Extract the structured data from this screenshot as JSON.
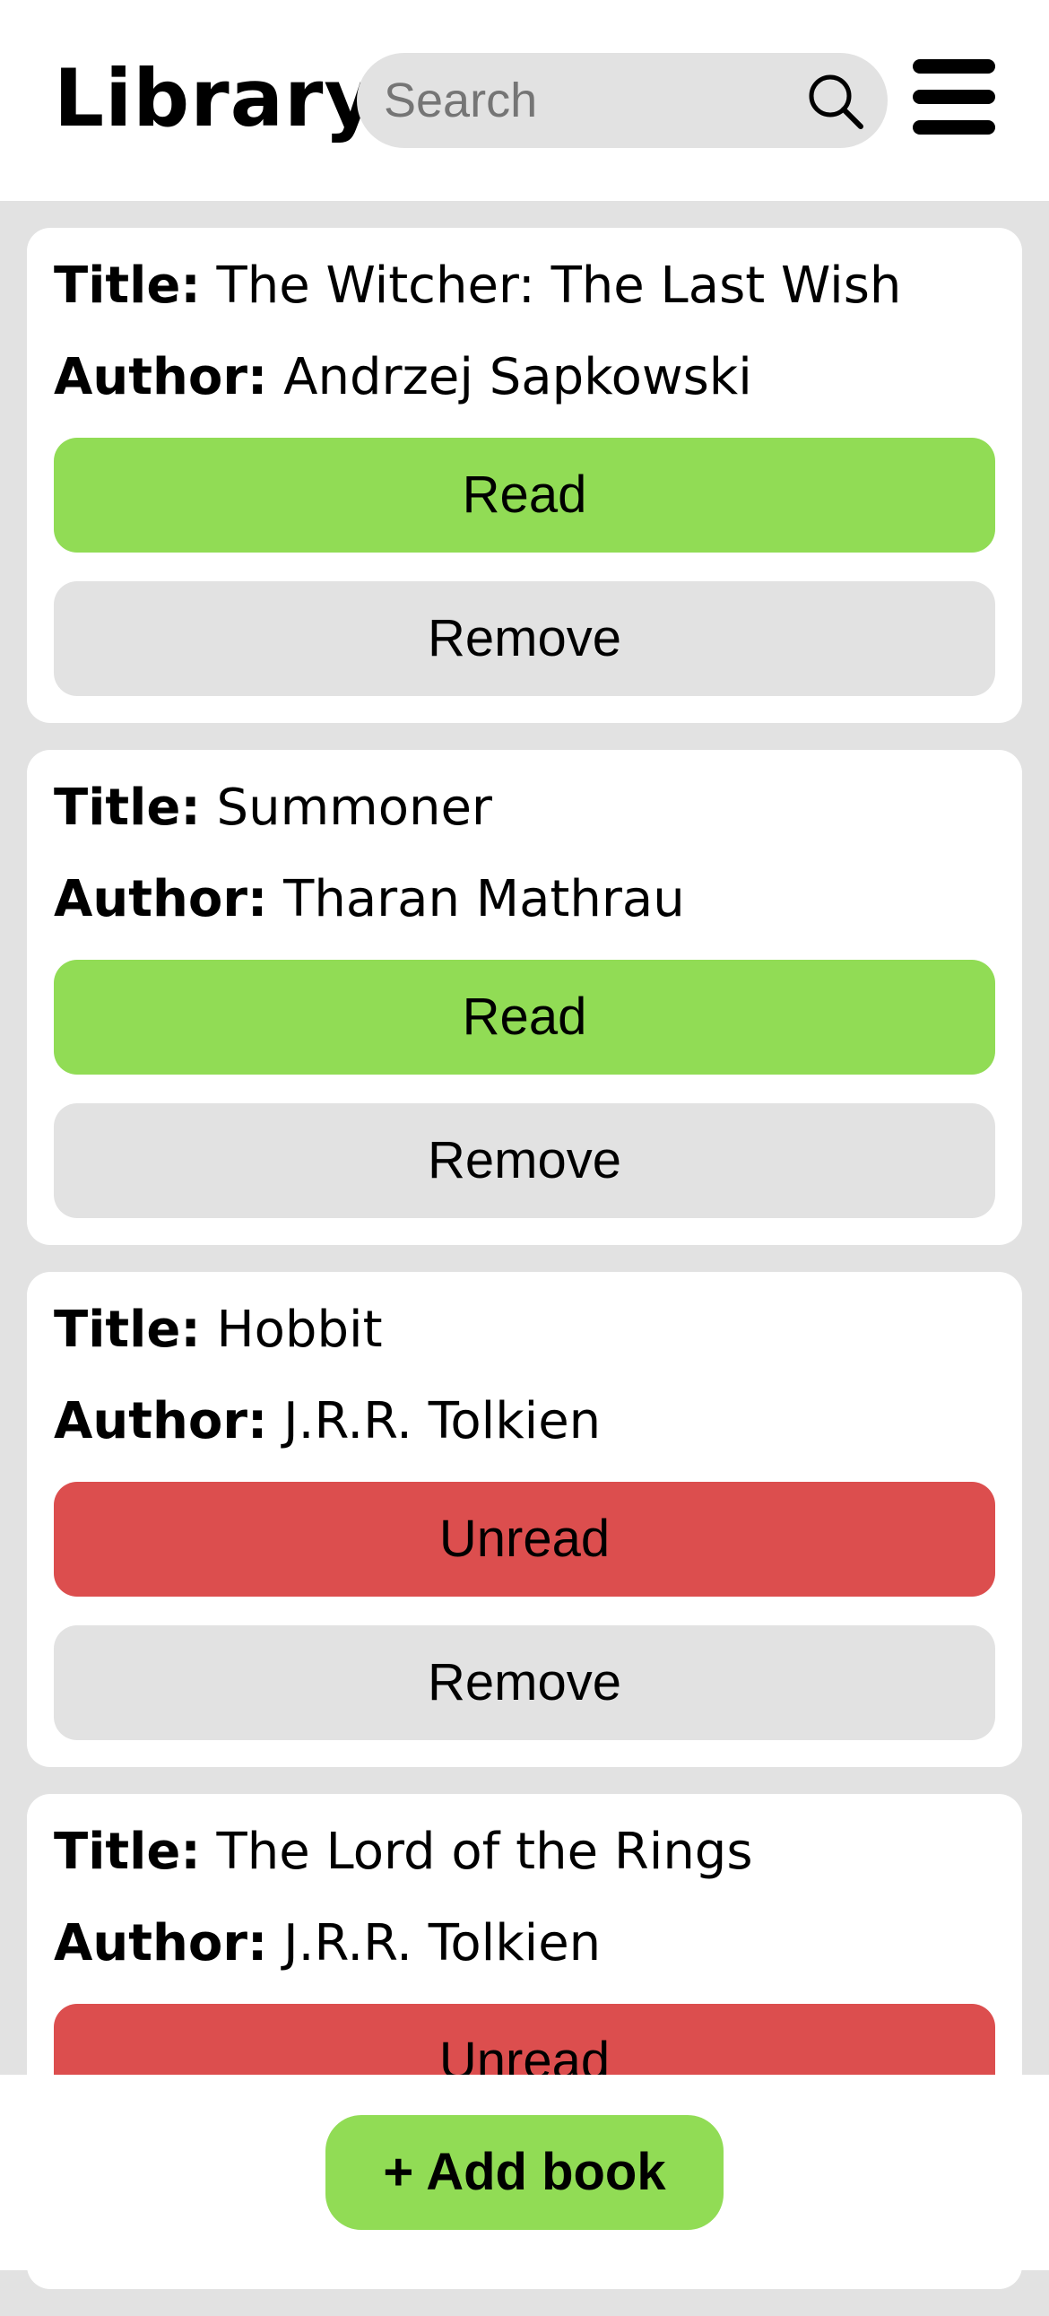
{
  "header": {
    "title": "Library",
    "search_placeholder": "Search",
    "search_value": ""
  },
  "labels": {
    "title": "Title:",
    "author": "Author:",
    "remove": "Remove"
  },
  "books": [
    {
      "title": "The Witcher: The Last Wish",
      "author": "Andrzej Sapkowski",
      "status": "Read"
    },
    {
      "title": "Summoner",
      "author": "Tharan Mathrau",
      "status": "Read"
    },
    {
      "title": "Hobbit",
      "author": "J.R.R. Tolkien",
      "status": "Unread"
    },
    {
      "title": "The Lord of the Rings",
      "author": "J.R.R. Tolkien",
      "status": "Unread"
    }
  ],
  "footer": {
    "add_label": "+ Add book"
  },
  "icons": {
    "search": "search-icon",
    "menu": "hamburger-menu-icon"
  },
  "colors": {
    "read": "#91dc55",
    "unread": "#dc4e4e",
    "background": "#e2e2e2",
    "card": "#ffffff"
  }
}
